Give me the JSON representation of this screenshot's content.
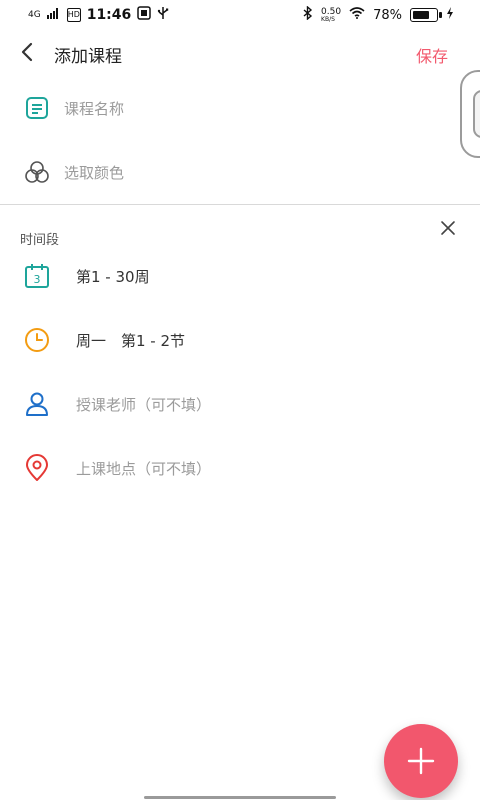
{
  "status_bar": {
    "network": "4G",
    "hd": "HD",
    "time": "11:46",
    "speed": "0.50",
    "speed_unit": "KB/S",
    "battery": "78%"
  },
  "toolbar": {
    "title": "添加课程",
    "save_label": "保存"
  },
  "course": {
    "name_placeholder": "课程名称",
    "color_placeholder": "选取颜色"
  },
  "time_slot": {
    "section_title": "时间段",
    "calendar_day": "3",
    "weeks": "第1 - 30周",
    "day_and_sessions": "周一　第1 - 2节",
    "teacher_placeholder": "授课老师（可不填）",
    "location_placeholder": "上课地点（可不填）"
  },
  "colors": {
    "accent": "#f2576d",
    "teal": "#1ea59b",
    "orange": "#f39c12",
    "blue": "#1e6fc9",
    "red": "#e53935"
  },
  "icons": {
    "back": "chevron-left-icon",
    "name": "note-icon",
    "color": "palette-icon",
    "weeks": "calendar-icon",
    "time": "clock-icon",
    "teacher": "person-icon",
    "location": "location-pin-icon",
    "close": "close-icon",
    "add": "plus-icon"
  }
}
